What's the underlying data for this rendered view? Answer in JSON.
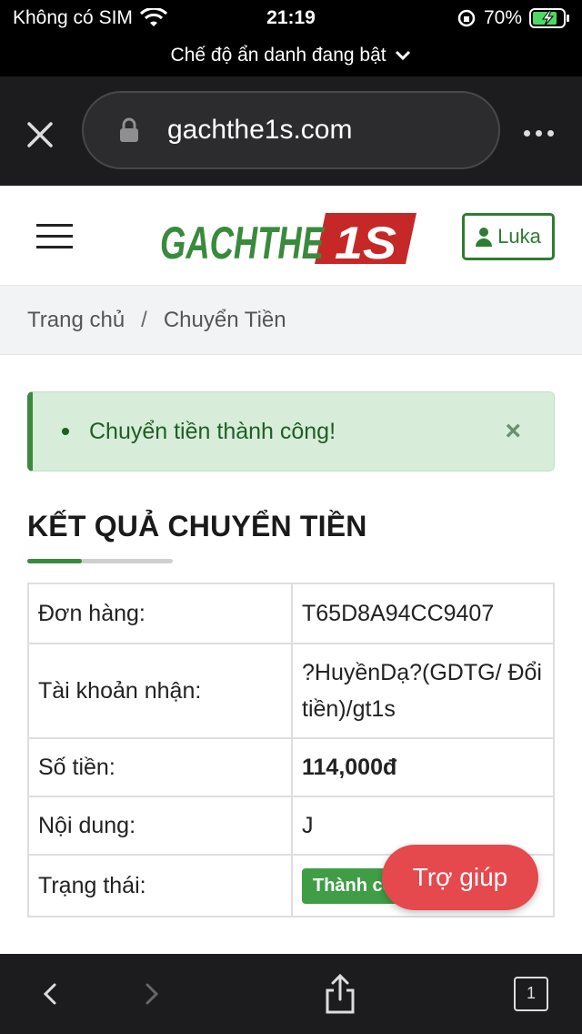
{
  "status_bar": {
    "carrier": "Không có SIM",
    "time": "21:19",
    "battery": "70%"
  },
  "incognito_banner": "Chế độ ẩn danh đang bật",
  "browser": {
    "url": "gachthe1s.com",
    "open_tabs": "1"
  },
  "header": {
    "logo_text_left": "GACHTHE",
    "logo_text_right": "1S",
    "user_label": "Luka"
  },
  "breadcrumb": {
    "home": "Trang chủ",
    "separator": "/",
    "current": "Chuyển Tiền"
  },
  "alert": {
    "message": "Chuyển tiền thành công!",
    "close_symbol": "×"
  },
  "result": {
    "title": "KẾT QUẢ CHUYỂN TIỀN",
    "rows": [
      {
        "label": "Đơn hàng:",
        "value": "T65D8A94CC9407"
      },
      {
        "label": "Tài khoản nhận:",
        "value": "?HuyềnDạ?(GDTG/ Đổi tiền)/gt1s"
      },
      {
        "label": "Số tiền:",
        "value": "114,000đ"
      },
      {
        "label": "Nội dung:",
        "value": "J"
      },
      {
        "label": "Trạng thái:",
        "value": "Thành công"
      }
    ]
  },
  "help_button": "Trợ giúp",
  "colors": {
    "brand_green": "#3a8a3e",
    "brand_red": "#c62828",
    "help_red": "#e5484d"
  }
}
